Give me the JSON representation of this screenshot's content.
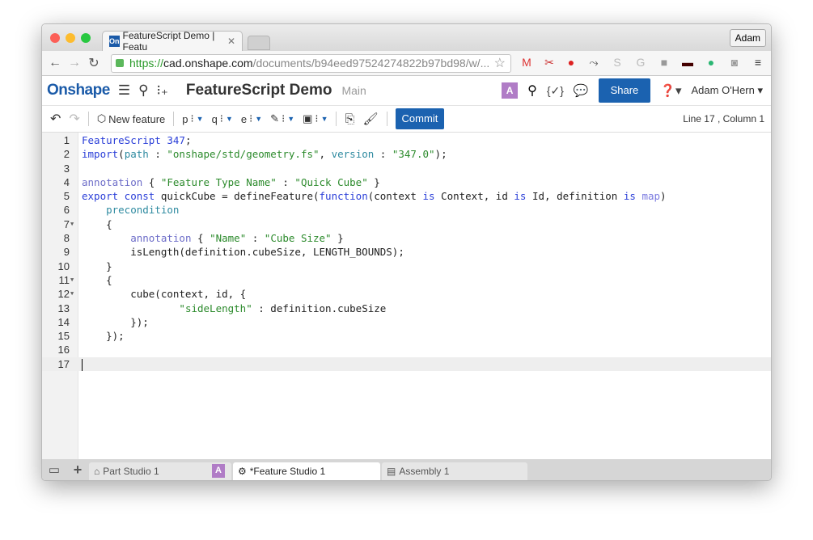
{
  "browser": {
    "tab_title": "FeatureScript Demo | Featu",
    "favicon_text": "On",
    "profile": "Adam",
    "url_scheme": "https://",
    "url_host": "cad.onshape.com",
    "url_path": "/documents/b94eed97524274822b97bd98/w/...",
    "extensions": [
      "gmail-icon",
      "scissors-icon",
      "pinterest-icon",
      "runner-icon",
      "s-icon",
      "g-icon",
      "shield-icon",
      "mask-icon",
      "grammarly-icon",
      "camera-icon"
    ]
  },
  "app": {
    "logo": "Onshape",
    "doc_title": "FeatureScript Demo",
    "branch": "Main",
    "avatar_letter": "A",
    "share": "Share",
    "user": "Adam O'Hern",
    "accent": "#1b62b0"
  },
  "toolbar": {
    "new_feature": "New feature",
    "tools": [
      "p",
      "q",
      "e",
      "",
      ""
    ],
    "commit": "Commit",
    "cursor_pos": "Line 17 , Column 1"
  },
  "editor": {
    "current_line": 17,
    "lines": [
      {
        "n": "1",
        "tokens": [
          {
            "k": "kw",
            "t": "FeatureScript 347"
          },
          {
            "k": "",
            "t": ";"
          }
        ]
      },
      {
        "n": "2",
        "tokens": [
          {
            "k": "kw",
            "t": "import"
          },
          {
            "k": "",
            "t": "("
          },
          {
            "k": "attr",
            "t": "path"
          },
          {
            "k": "",
            "t": " : "
          },
          {
            "k": "str",
            "t": "\"onshape/std/geometry.fs\""
          },
          {
            "k": "",
            "t": ", "
          },
          {
            "k": "attr",
            "t": "version"
          },
          {
            "k": "",
            "t": " : "
          },
          {
            "k": "str",
            "t": "\"347.0\""
          },
          {
            "k": "",
            "t": ");"
          }
        ]
      },
      {
        "n": "3",
        "tokens": []
      },
      {
        "n": "4",
        "tokens": [
          {
            "k": "ann",
            "t": "annotation"
          },
          {
            "k": "",
            "t": " { "
          },
          {
            "k": "str",
            "t": "\"Feature Type Name\""
          },
          {
            "k": "",
            "t": " : "
          },
          {
            "k": "str",
            "t": "\"Quick Cube\""
          },
          {
            "k": "",
            "t": " }"
          }
        ]
      },
      {
        "n": "5",
        "tokens": [
          {
            "k": "kw",
            "t": "export const"
          },
          {
            "k": "",
            "t": " quickCube = defineFeature("
          },
          {
            "k": "kw",
            "t": "function"
          },
          {
            "k": "",
            "t": "(context "
          },
          {
            "k": "kw",
            "t": "is"
          },
          {
            "k": "",
            "t": " Context, id "
          },
          {
            "k": "kw",
            "t": "is"
          },
          {
            "k": "",
            "t": " Id, definition "
          },
          {
            "k": "kw",
            "t": "is"
          },
          {
            "k": "",
            "t": " "
          },
          {
            "k": "type",
            "t": "map"
          },
          {
            "k": "",
            "t": ")"
          }
        ]
      },
      {
        "n": "6",
        "tokens": [
          {
            "k": "",
            "t": "    "
          },
          {
            "k": "attr",
            "t": "precondition"
          }
        ]
      },
      {
        "n": "7",
        "fold": true,
        "tokens": [
          {
            "k": "",
            "t": "    {"
          }
        ]
      },
      {
        "n": "8",
        "tokens": [
          {
            "k": "",
            "t": "        "
          },
          {
            "k": "ann",
            "t": "annotation"
          },
          {
            "k": "",
            "t": " { "
          },
          {
            "k": "str",
            "t": "\"Name\""
          },
          {
            "k": "",
            "t": " : "
          },
          {
            "k": "str",
            "t": "\"Cube Size\""
          },
          {
            "k": "",
            "t": " }"
          }
        ]
      },
      {
        "n": "9",
        "tokens": [
          {
            "k": "",
            "t": "        isLength(definition.cubeSize, LENGTH_BOUNDS);"
          }
        ]
      },
      {
        "n": "10",
        "tokens": [
          {
            "k": "",
            "t": "    }"
          }
        ]
      },
      {
        "n": "11",
        "fold": true,
        "tokens": [
          {
            "k": "",
            "t": "    {"
          }
        ]
      },
      {
        "n": "12",
        "fold": true,
        "tokens": [
          {
            "k": "",
            "t": "        cube(context, id, {"
          }
        ]
      },
      {
        "n": "13",
        "tokens": [
          {
            "k": "",
            "t": "                "
          },
          {
            "k": "str",
            "t": "\"sideLength\""
          },
          {
            "k": "",
            "t": " : definition.cubeSize"
          }
        ]
      },
      {
        "n": "14",
        "tokens": [
          {
            "k": "",
            "t": "        });"
          }
        ]
      },
      {
        "n": "15",
        "tokens": [
          {
            "k": "",
            "t": "    });"
          }
        ]
      },
      {
        "n": "16",
        "tokens": []
      },
      {
        "n": "17",
        "tokens": []
      }
    ]
  },
  "tabs": [
    {
      "label": "Part Studio 1",
      "badge": "A",
      "icon": "part-studio-icon"
    },
    {
      "label": "*Feature Studio 1",
      "icon": "feature-studio-icon",
      "active": true
    },
    {
      "label": "Assembly 1",
      "icon": "assembly-icon"
    }
  ]
}
